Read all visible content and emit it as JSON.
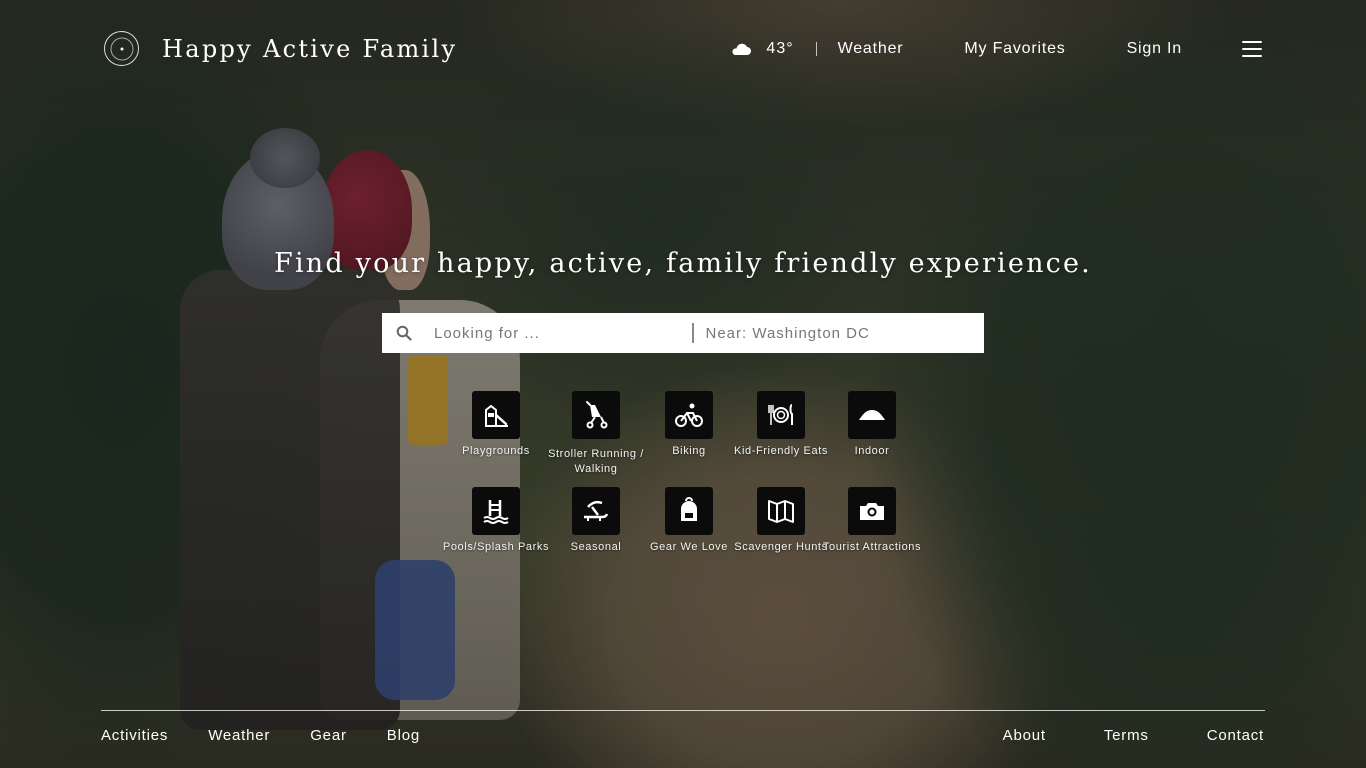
{
  "header": {
    "brand": "Happy Active Family",
    "logo_icon": "compass-logo-icon",
    "weather": {
      "icon": "cloud-icon",
      "temperature": "43°"
    },
    "nav": [
      "Weather",
      "My Favorites",
      "Sign In"
    ],
    "menu_icon": "hamburger-menu-icon"
  },
  "hero": {
    "headline": "Find your happy, active, family friendly experience.",
    "search": {
      "icon": "search-icon",
      "looking_placeholder": "Looking for ...",
      "near_placeholder": "Near: Washington DC"
    }
  },
  "categories": [
    {
      "label": "Playgrounds",
      "icon": "playground-icon"
    },
    {
      "label": "Stroller Running / Walking",
      "icon": "stroller-icon"
    },
    {
      "label": "Biking",
      "icon": "bike-icon"
    },
    {
      "label": "Kid-Friendly Eats",
      "icon": "plate-utensils-icon"
    },
    {
      "label": "Indoor",
      "icon": "indoor-icon"
    },
    {
      "label": "Pools/Splash Parks",
      "icon": "pool-ladder-icon"
    },
    {
      "label": "Seasonal",
      "icon": "sled-icon"
    },
    {
      "label": "Gear We Love",
      "icon": "backpack-icon"
    },
    {
      "label": "Scavenger Hunts",
      "icon": "map-icon"
    },
    {
      "label": "Tourist Attractions",
      "icon": "camera-icon"
    }
  ],
  "footer": {
    "left": [
      "Activities",
      "Weather",
      "Gear",
      "Blog"
    ],
    "right": [
      "About",
      "Terms",
      "Contact"
    ]
  },
  "colors": {
    "tile_background": "#0b0b0b",
    "text": "#ffffff",
    "search_background": "#ffffff"
  }
}
